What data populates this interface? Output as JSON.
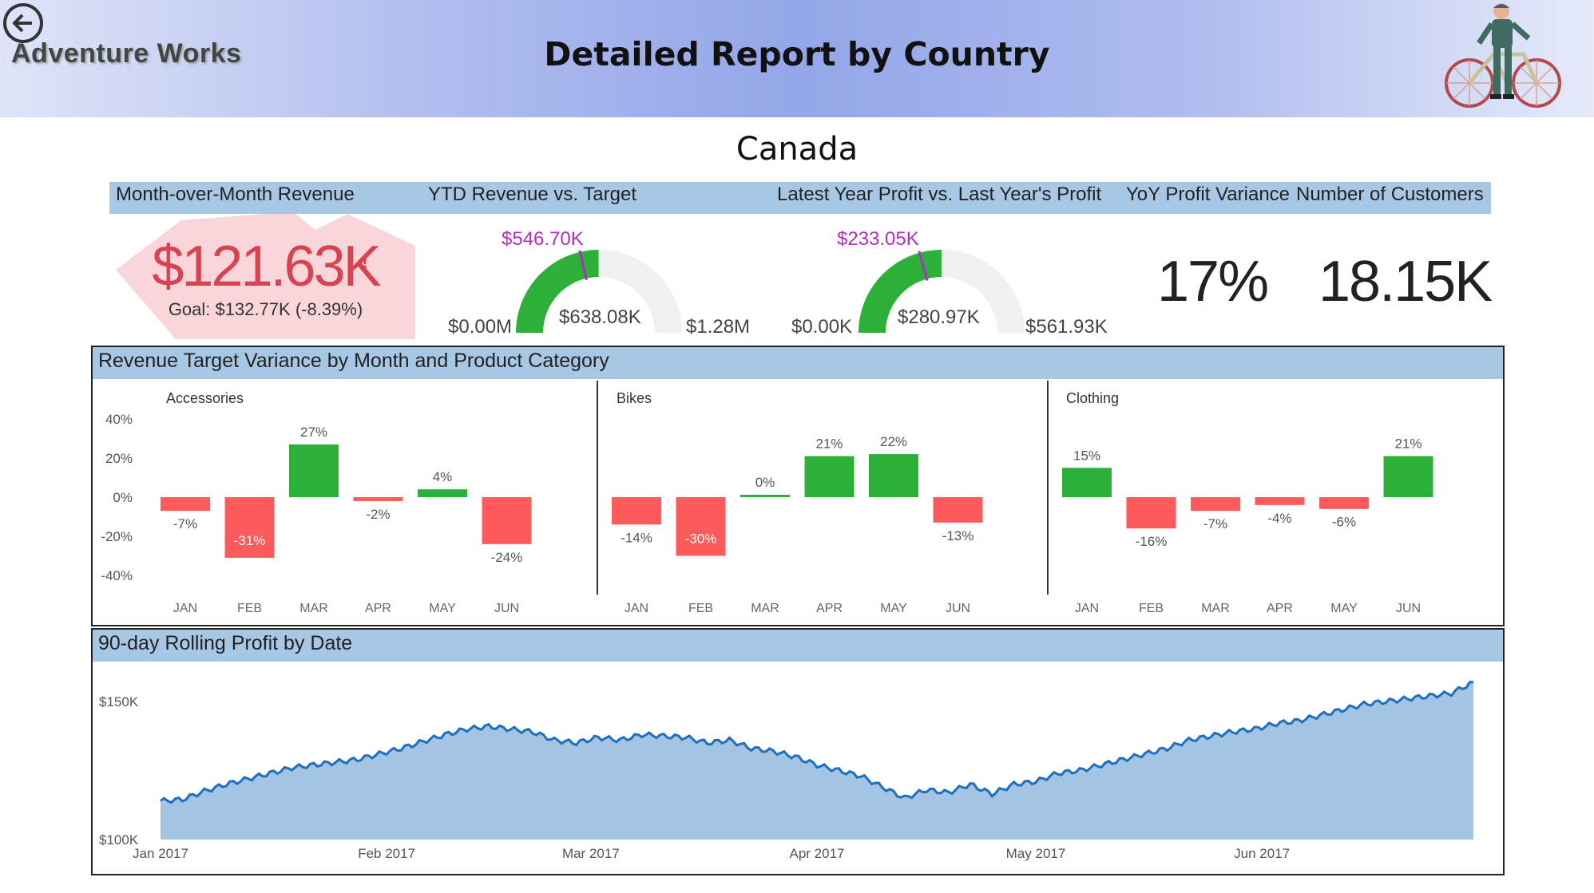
{
  "header": {
    "app_title": "Adventure Works",
    "report_title": "Detailed Report by Country",
    "back_icon": "arrow-left-circle-icon",
    "illustration": "cyclist-with-bicycle"
  },
  "country": "Canada",
  "kpis": {
    "mom_revenue": {
      "label": "Month-over-Month Revenue",
      "value": "$121.63K",
      "goal": "Goal: $132.77K (-8.39%)",
      "status_flag": "!",
      "status_color": "#d94351"
    },
    "ytd_revenue": {
      "label": "YTD Revenue vs. Target",
      "value": "$638.08K",
      "min": "$0.00M",
      "max": "$1.28M",
      "target": "$546.70K",
      "value_fraction": 0.4985,
      "target_fraction": 0.4271
    },
    "profit_vs_last_year": {
      "label": "Latest Year Profit vs. Last Year's Profit",
      "value": "$280.97K",
      "min": "$0.00K",
      "max": "$561.93K",
      "target": "$233.05K",
      "value_fraction": 0.5,
      "target_fraction": 0.4147
    },
    "yoy_profit_variance": {
      "label": "YoY Profit Variance",
      "value": "17%"
    },
    "customers": {
      "label": "Number of Customers",
      "value": "18.15K"
    }
  },
  "colors": {
    "positive": "#2db039",
    "negative": "#fd5b5b",
    "header_band": "#a6c8e4",
    "gauge_fill": "#2db039",
    "gauge_track": "#f0f0f0",
    "target_marker": "#b12ec0",
    "area_fill": "#a3c4e2",
    "line": "#1f6fbf"
  },
  "variance_section": {
    "title": "Revenue Target Variance by Month and Product Category",
    "y_ticks": [
      "40%",
      "20%",
      "0%",
      "-20%",
      "-40%"
    ]
  },
  "rolling_section": {
    "title": "90-day Rolling Profit by Date"
  },
  "chart_data": [
    {
      "type": "bar",
      "title": "Accessories",
      "categories": [
        "JAN",
        "FEB",
        "MAR",
        "APR",
        "MAY",
        "JUN"
      ],
      "values": [
        -7,
        -31,
        27,
        -2,
        4,
        -24
      ],
      "labels": [
        "-7%",
        "-31%",
        "27%",
        "-2%",
        "4%",
        "-24%"
      ],
      "ylim": [
        -40,
        40
      ],
      "y_ticks": [
        "40%",
        "20%",
        "0%",
        "-20%",
        "-40%"
      ]
    },
    {
      "type": "bar",
      "title": "Bikes",
      "categories": [
        "JAN",
        "FEB",
        "MAR",
        "APR",
        "MAY",
        "JUN"
      ],
      "values": [
        -14,
        -30,
        0,
        21,
        22,
        -13
      ],
      "labels": [
        "-14%",
        "-30%",
        "0%",
        "21%",
        "22%",
        "-13%"
      ],
      "ylim": [
        -40,
        40
      ]
    },
    {
      "type": "bar",
      "title": "Clothing",
      "categories": [
        "JAN",
        "FEB",
        "MAR",
        "APR",
        "MAY",
        "JUN"
      ],
      "values": [
        15,
        -16,
        -7,
        -4,
        -6,
        21
      ],
      "labels": [
        "15%",
        "-16%",
        "-7%",
        "-4%",
        "-6%",
        "21%"
      ],
      "ylim": [
        -40,
        40
      ]
    },
    {
      "type": "area",
      "y_ticks": [
        "$150K",
        "$100K"
      ],
      "ylim": [
        100,
        150
      ],
      "x_tick_labels": [
        "Jan 2017",
        "Feb 2017",
        "Mar 2017",
        "Apr 2017",
        "May 2017",
        "Jun 2017"
      ],
      "x_tick_days": [
        0,
        31,
        59,
        90,
        120,
        151
      ],
      "x_range_days": [
        0,
        180
      ],
      "points": [
        [
          0,
          114
        ],
        [
          3,
          114.5
        ],
        [
          6,
          117.5
        ],
        [
          9,
          120
        ],
        [
          12,
          122
        ],
        [
          15,
          124
        ],
        [
          18,
          126
        ],
        [
          21,
          127
        ],
        [
          24,
          128
        ],
        [
          27,
          129
        ],
        [
          30,
          131
        ],
        [
          33,
          133
        ],
        [
          36,
          135.5
        ],
        [
          39,
          138
        ],
        [
          42,
          140
        ],
        [
          45,
          141
        ],
        [
          48,
          140
        ],
        [
          51,
          139
        ],
        [
          54,
          136
        ],
        [
          57,
          135
        ],
        [
          60,
          137
        ],
        [
          63,
          136
        ],
        [
          66,
          138
        ],
        [
          69,
          137.5
        ],
        [
          72,
          137
        ],
        [
          75,
          135
        ],
        [
          78,
          136
        ],
        [
          81,
          133
        ],
        [
          84,
          132
        ],
        [
          87,
          130
        ],
        [
          90,
          127
        ],
        [
          93,
          125
        ],
        [
          96,
          123
        ],
        [
          99,
          119
        ],
        [
          102,
          115
        ],
        [
          105,
          118
        ],
        [
          108,
          117
        ],
        [
          111,
          120
        ],
        [
          114,
          116.5
        ],
        [
          117,
          120
        ],
        [
          120,
          121
        ],
        [
          123,
          124
        ],
        [
          126,
          125
        ],
        [
          129,
          127
        ],
        [
          132,
          129
        ],
        [
          135,
          131
        ],
        [
          138,
          133
        ],
        [
          141,
          136
        ],
        [
          144,
          137.5
        ],
        [
          147,
          139
        ],
        [
          150,
          140
        ],
        [
          153,
          142
        ],
        [
          156,
          143
        ],
        [
          159,
          145
        ],
        [
          162,
          147
        ],
        [
          165,
          149
        ],
        [
          168,
          150
        ],
        [
          171,
          151
        ],
        [
          174,
          152
        ],
        [
          177,
          153
        ],
        [
          180,
          157
        ]
      ]
    }
  ]
}
